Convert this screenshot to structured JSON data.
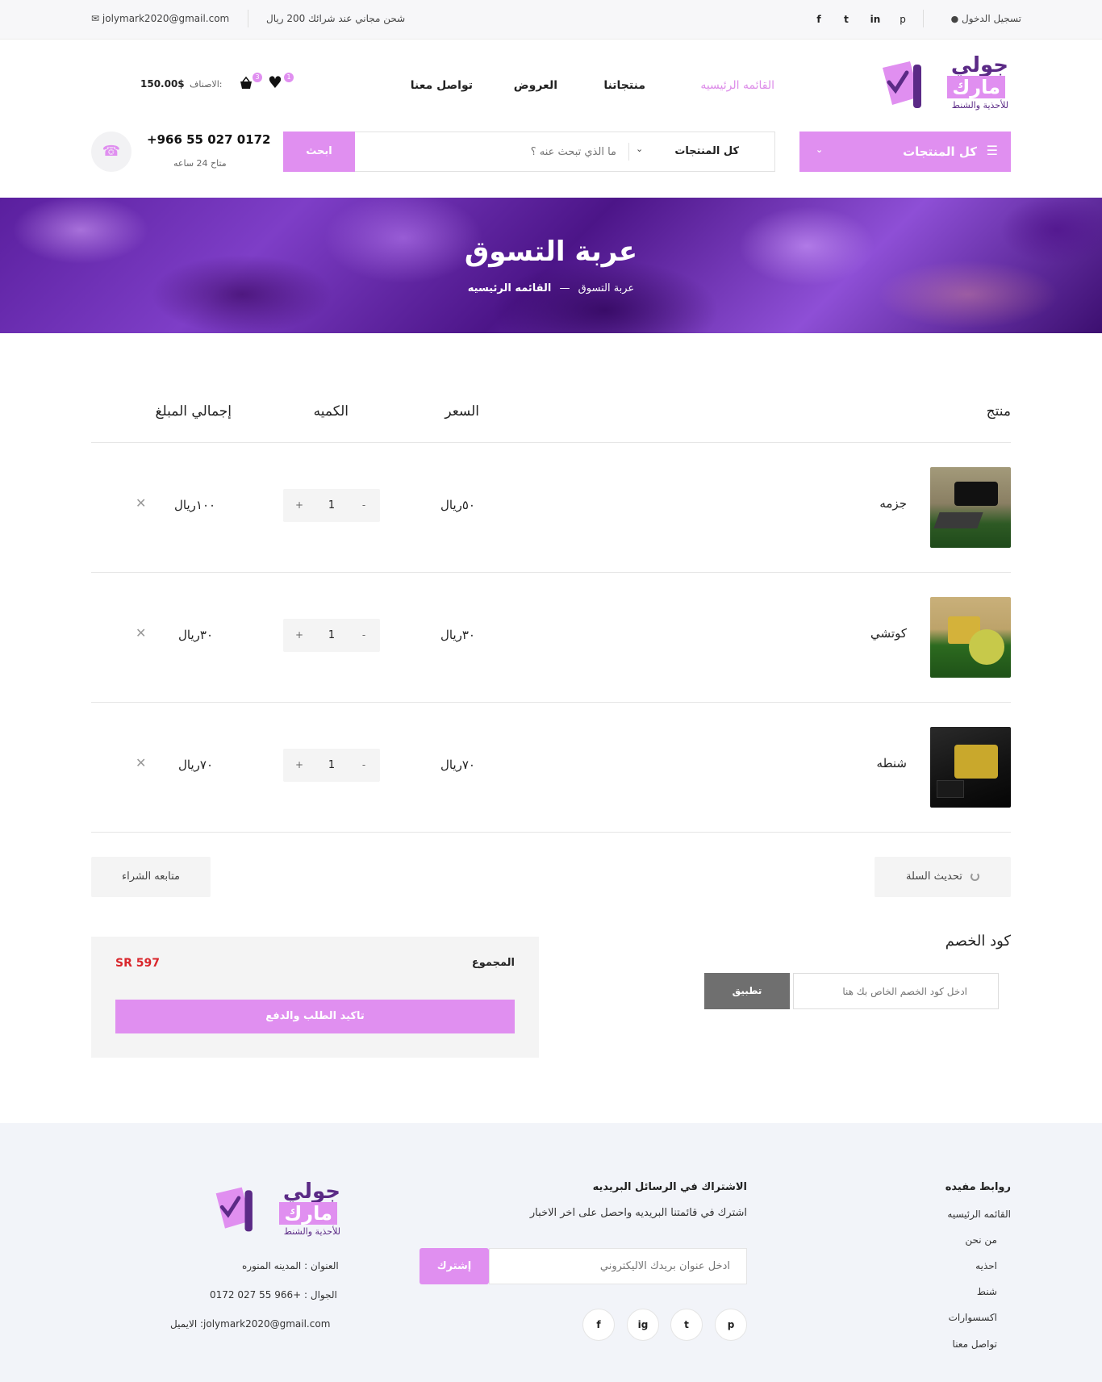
{
  "topbar": {
    "login": "تسجيل الدخول",
    "social": [
      "f",
      "t",
      "in",
      "p"
    ],
    "shipping": "شحن مجاني عند شرائك 200 ريال",
    "email": "jolymark2020@gmail.com"
  },
  "logo": {
    "line1": "جولي",
    "line2": "مارك",
    "line3": "للأحذية والشنط"
  },
  "nav": [
    "القائمه الرئيسيه",
    "منتجاتنا",
    "العروض",
    "تواصل معنا"
  ],
  "cart": {
    "wish_count": "1",
    "cart_count": "3",
    "label": "الاصناف:",
    "total": "150.00$"
  },
  "categories_button": "كل المنتجات",
  "search": {
    "category": "كل المنتجات",
    "placeholder": "ما الذي تبحث عنه ؟",
    "button": "ابحث"
  },
  "phone": {
    "number": "+966 55 027 0172",
    "hours": "متاح 24 ساعه"
  },
  "banner": {
    "title": "عربة التسوق",
    "crumb_home": "القائمه الرئيسيه",
    "crumb_sep": "—",
    "crumb_current": "عربة التسوق"
  },
  "table": {
    "headers": {
      "product": "منتج",
      "price": "السعر",
      "qty": "الكميه",
      "total": "إجمالي المبلغ"
    },
    "rows": [
      {
        "name": "جزمه",
        "price": "٥٠ريال",
        "qty": "1",
        "total": "١٠٠ريال"
      },
      {
        "name": "كوتشي",
        "price": "٣٠ريال",
        "qty": "1",
        "total": "٣٠ريال"
      },
      {
        "name": "شنطه",
        "price": "٧٠ريال",
        "qty": "1",
        "total": "٧٠ريال"
      }
    ]
  },
  "actions": {
    "update": "تحديث السلة",
    "continue": "متابعه الشراء"
  },
  "coupon": {
    "title": "كود الخصم",
    "placeholder": "ادخل كود الخصم الخاص بك هنا",
    "apply": "تطبيق"
  },
  "totals": {
    "label": "المجموع",
    "value": "SR 597",
    "checkout": "تاكيد الطلب والدفع"
  },
  "footer": {
    "links_title": "روابط مفيده",
    "links": [
      "القائمه الرئيسيه",
      "من نحن",
      "احذيه",
      "شنط",
      "اكسسوارات",
      "تواصل معنا"
    ],
    "newsletter_title": "الاشتراك في الرسائل البريديه",
    "newsletter_text": "اشترك في قائمتنا البريديه واحصل على اخر الاخبار",
    "newsletter_placeholder": "ادخل عنوان بريدك الاليكتروني",
    "subscribe": "إشترك",
    "social": [
      "p",
      "t",
      "ig",
      "f"
    ],
    "address": "العنوان : المدينه المنوره",
    "mobile": "الجوال : +966 55 027 0172",
    "email": "الايميل :jolymark2020@gmail.com"
  },
  "colors": {
    "accent": "#e08ff0",
    "price_red": "#d9262b"
  }
}
